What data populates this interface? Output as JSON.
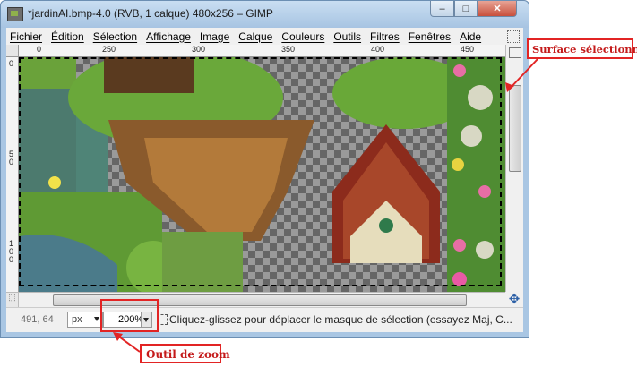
{
  "window": {
    "title": "*jardinAI.bmp-4.0 (RVB, 1 calque) 480x256 – GIMP",
    "minimize": "–",
    "maximize": "□",
    "close": "✕"
  },
  "menu": [
    "Fichier",
    "Édition",
    "Sélection",
    "Affichage",
    "Image",
    "Calque",
    "Couleurs",
    "Outils",
    "Filtres",
    "Fenêtres",
    "Aide"
  ],
  "rulers": {
    "horizontal": [
      "0",
      "250",
      "300",
      "350",
      "400",
      "450"
    ],
    "vertical": [
      "0",
      "5\n0",
      "1\n0\n0"
    ]
  },
  "status": {
    "coords": "491, 64",
    "unit": "px",
    "zoom": "200%",
    "message": "Cliquez-glissez pour déplacer le masque de sélection (essayez Maj, C..."
  },
  "annotations": {
    "surface": "Surface sélectionné",
    "zoom": "Outil de zoom"
  },
  "colors": {
    "accent": "#e22424",
    "frame": "#a9c6e3"
  }
}
